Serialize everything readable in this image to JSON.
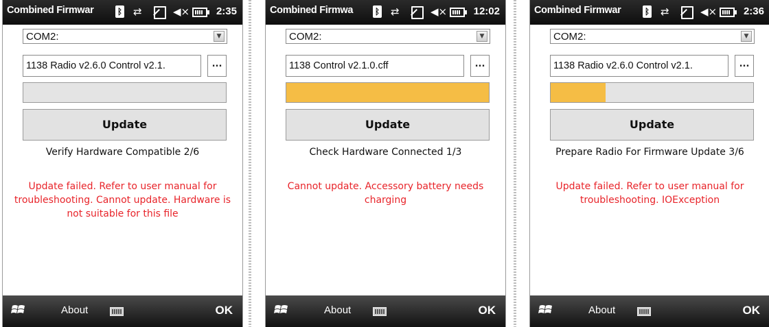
{
  "accent_progress_color": "#f5bd45",
  "error_color": "#e8242a",
  "screens": [
    {
      "title": "Combined Firmwar",
      "time": "2:35",
      "port": "COM2:",
      "file": "1138 Radio v2.6.0 Control v2.1.",
      "browse_label": "...",
      "progress": 0,
      "update_label": "Update",
      "status": "Verify Hardware Compatible 2/6",
      "error": "Update failed. Refer to user manual for troubleshooting. Cannot update. Hardware is not suitable for this file",
      "menu_about": "About",
      "menu_ok": "OK"
    },
    {
      "title": "Combined Firmwa",
      "time": "12:02",
      "port": "COM2:",
      "file": "1138 Control v2.1.0.cff",
      "browse_label": "...",
      "progress": 1,
      "update_label": "Update",
      "status": "Check Hardware Connected 1/3",
      "error": "Cannot update. Accessory battery needs charging",
      "menu_about": "About",
      "menu_ok": "OK"
    },
    {
      "title": "Combined Firmwar",
      "time": "2:36",
      "port": "COM2:",
      "file": "1138 Radio v2.6.0 Control v2.1.",
      "browse_label": "...",
      "progress": 0.27,
      "update_label": "Update",
      "status": "Prepare Radio For Firmware Update 3/6",
      "error": "Update failed. Refer to user manual for troubleshooting. IOException",
      "menu_about": "About",
      "menu_ok": "OK"
    }
  ]
}
